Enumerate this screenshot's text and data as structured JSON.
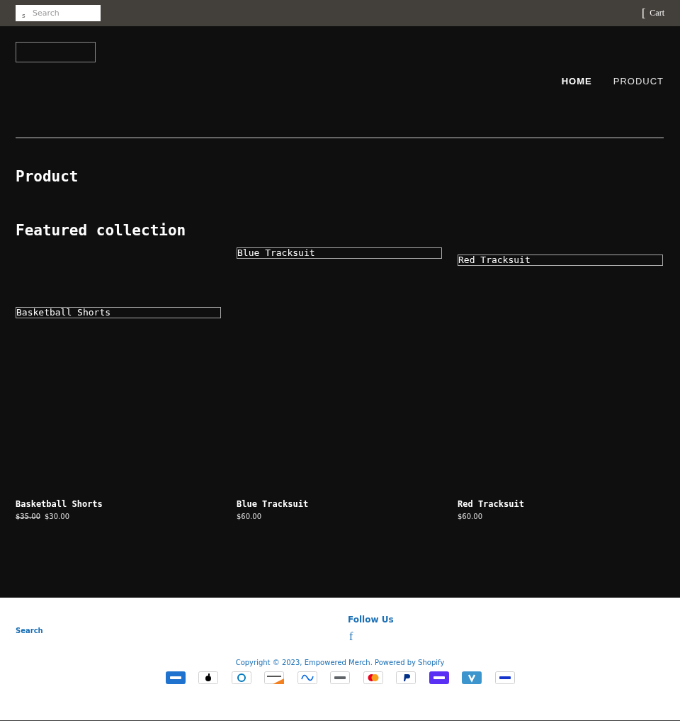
{
  "top_bar": {
    "search": {
      "icon_glyph": "s",
      "placeholder": "Search"
    },
    "cart": {
      "icon_glyph": "[",
      "label": "Cart"
    }
  },
  "nav": [
    {
      "label": "HOME",
      "selected": true
    },
    {
      "label": "PRODUCT",
      "selected": false
    }
  ],
  "page_title": "Product",
  "section_title": "Featured collection",
  "products": [
    {
      "image_alt": "Basketball Shorts",
      "name": "Basketball Shorts",
      "compare_price": "$35.00",
      "price": "$30.00"
    },
    {
      "image_alt": "Blue Tracksuit",
      "name": "Blue Tracksuit",
      "price": "$60.00"
    },
    {
      "image_alt": "Red Tracksuit",
      "name": "Red Tracksuit",
      "price": "$60.00"
    }
  ],
  "footer": {
    "links": [
      "Search"
    ],
    "follow_title": "Follow Us",
    "social_glyph": "f",
    "copyright": {
      "prefix": "Copyright © 2023, ",
      "store": "Empowered Merch",
      "separator": ". ",
      "powered": "Powered by Shopify"
    },
    "payments": [
      {
        "kind": "amex"
      },
      {
        "kind": "apple"
      },
      {
        "kind": "diners"
      },
      {
        "kind": "discover"
      },
      {
        "kind": "meta"
      },
      {
        "kind": "google"
      },
      {
        "kind": "mastercard"
      },
      {
        "kind": "paypal"
      },
      {
        "kind": "shop"
      },
      {
        "kind": "venmo"
      },
      {
        "kind": "visa"
      }
    ]
  }
}
